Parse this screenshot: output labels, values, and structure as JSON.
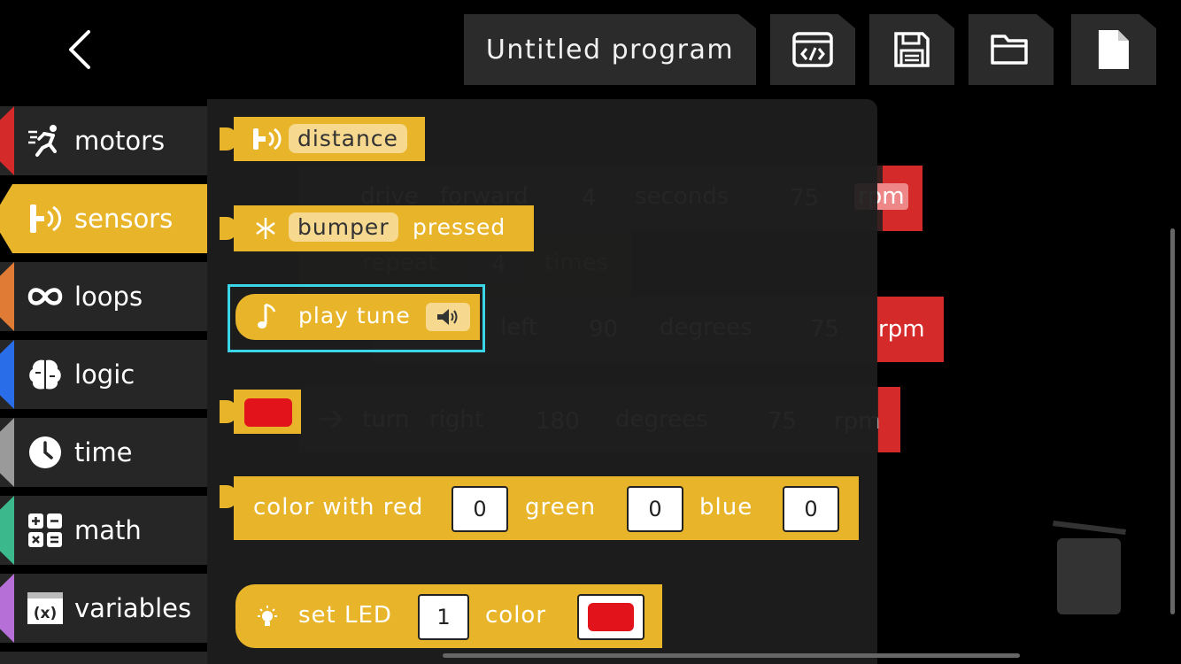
{
  "header": {
    "program_title": "Untitled program",
    "buttons": [
      {
        "name": "code-view-button",
        "icon": "code-icon"
      },
      {
        "name": "save-button",
        "icon": "save-icon"
      },
      {
        "name": "open-button",
        "icon": "folder-icon"
      },
      {
        "name": "new-button",
        "icon": "new-file-icon"
      }
    ]
  },
  "sidebar": {
    "items": [
      {
        "label": "motors",
        "color": "#d42a2a",
        "icon": "running-person-icon"
      },
      {
        "label": "sensors",
        "color": "#e8b52a",
        "icon": "sensor-icon",
        "active": true
      },
      {
        "label": "loops",
        "color": "#e07b35",
        "icon": "infinity-icon"
      },
      {
        "label": "logic",
        "color": "#2a6de8",
        "icon": "brain-icon"
      },
      {
        "label": "time",
        "color": "#9a9a9a",
        "icon": "clock-icon"
      },
      {
        "label": "math",
        "color": "#3cb98c",
        "icon": "calculator-icon"
      },
      {
        "label": "variables",
        "color": "#b56fd6",
        "icon": "variable-icon"
      }
    ]
  },
  "palette": {
    "distance": {
      "label": "distance"
    },
    "bumper": {
      "label": "bumper",
      "suffix": "pressed"
    },
    "play_tune": {
      "label": "play tune",
      "icon": "speaker-icon"
    },
    "color_swatch": {
      "color": "#e3131b"
    },
    "color_rgb": {
      "prefix": "color with red",
      "red": "0",
      "green_label": "green",
      "green": "0",
      "blue_label": "blue",
      "blue": "0"
    },
    "set_led": {
      "prefix": "set LED",
      "led": "1",
      "color_label": "color",
      "color": "#e3131b"
    }
  },
  "workspace": {
    "drive": {
      "label": "drive",
      "direction": "forward",
      "value": "4",
      "unit": "seconds",
      "speed": "75",
      "speed_unit": "rpm"
    },
    "repeat": {
      "label": "repeat",
      "count": "4",
      "unit": "times"
    },
    "turn_left": {
      "direction": "left",
      "value": "90",
      "unit": "degrees",
      "speed": "75",
      "speed_unit": "rpm"
    },
    "turn_right": {
      "label": "turn",
      "direction": "right",
      "value": "180",
      "unit": "degrees",
      "speed": "75",
      "speed_unit": "rpm"
    }
  },
  "colors": {
    "accent": "#e8b52a",
    "motor_red": "#d42a2a",
    "highlight": "#3ad6e8"
  }
}
